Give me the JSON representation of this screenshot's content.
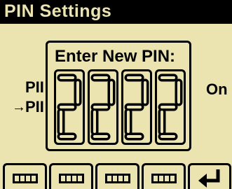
{
  "header": {
    "title": "PIN Settings"
  },
  "background_rows": {
    "row1_label": "PII",
    "row1_value": "On",
    "row2_arrow": "→",
    "row2_label": "PII"
  },
  "dialog": {
    "title": "Enter New PIN:",
    "digits": [
      "2",
      "2",
      "2",
      "2"
    ]
  },
  "softkeys": [
    {
      "icon": "digit-select-icon"
    },
    {
      "icon": "digit-select-icon"
    },
    {
      "icon": "digit-select-icon"
    },
    {
      "icon": "digit-select-icon"
    },
    {
      "icon": "enter-return-icon"
    }
  ],
  "colors": {
    "background": "#ece4b0",
    "foreground": "#000000"
  }
}
